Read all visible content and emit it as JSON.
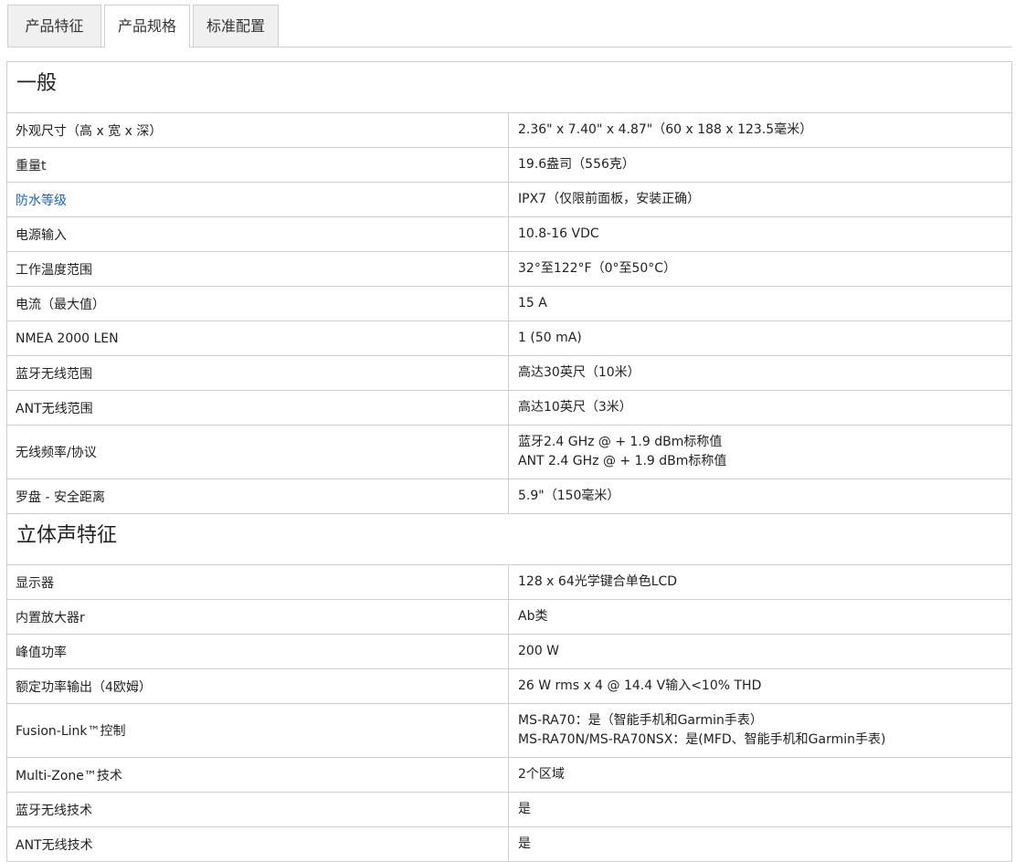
{
  "tabs": [
    "产品特征",
    "产品规格",
    "标准配置"
  ],
  "active_tab": "产品规格",
  "sections": [
    {
      "title": "一般",
      "rows": [
        {
          "label": "外观尺寸（高 x 宽 x 深）",
          "value": "2.36\" x 7.40\" x 4.87\"（60 x 188 x 123.5毫米）"
        },
        {
          "label": "重量t",
          "value": "19.6盎司（556克）"
        },
        {
          "label": "防水等级",
          "value": "IPX7（仅限前面板，安装正确）"
        },
        {
          "label": "电源输入",
          "value": "10.8-16 VDC"
        },
        {
          "label": "工作温度范围",
          "value": "32°至122°F（0°至50°C）"
        },
        {
          "label": "电流（最大值）",
          "value": "15 A"
        },
        {
          "label": "NMEA 2000 LEN",
          "value": "1 (50 mA)"
        },
        {
          "label": "蓝牙无线范围",
          "value": "高达30英尺（10米）"
        },
        {
          "label": "ANT无线范围",
          "value": "高达10英尺（3米）"
        },
        {
          "label": "无线频率/协议",
          "value": "蓝牙2.4 GHz @ + 1.9 dBm标称值",
          "value2": "ANT 2.4 GHz @ + 1.9 dBm标称值"
        },
        {
          "label": "罗盘 - 安全距离",
          "value": "5.9\"（150毫米）"
        }
      ]
    },
    {
      "title": "立体声特征",
      "rows": [
        {
          "label": "显示器",
          "value": "128 x 64光学键合单色LCD"
        },
        {
          "label": "内置放大器r",
          "value": "Ab类"
        },
        {
          "label": "峰值功率",
          "value": "200 W"
        },
        {
          "label": "额定功率输出（4欧姆）",
          "value": "26 W rms x 4 @ 14.4 V输入<10% THD"
        },
        {
          "label": "Fusion-Link™控制",
          "value": "MS-RA70：是（智能手机和Garmin手表）",
          "value2": "MS-RA70N/MS-RA70NSX：是(MFD、智能手机和Garmin手表)"
        },
        {
          "label": "Multi-Zone™技术",
          "value": "2个区域"
        },
        {
          "label": "蓝牙无线技术",
          "value": "是"
        },
        {
          "label": "ANT无线技术",
          "value": "是"
        }
      ]
    }
  ]
}
